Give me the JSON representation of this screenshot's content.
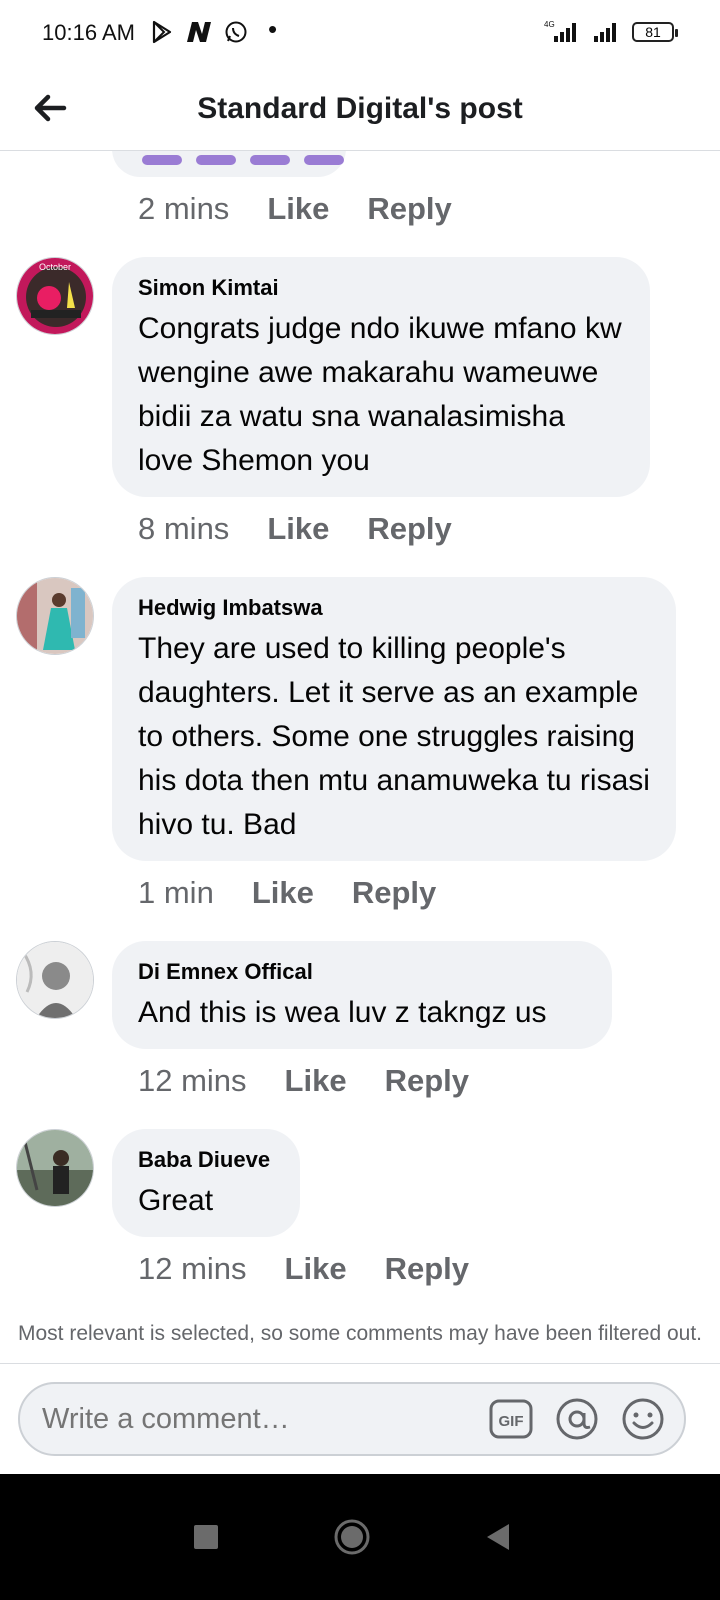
{
  "status_bar": {
    "time": "10:16 AM",
    "battery": "81",
    "network": "4G"
  },
  "header": {
    "title": "Standard Digital's post"
  },
  "comments": [
    {
      "name": "",
      "text": "",
      "time": "2 mins",
      "like": "Like",
      "reply": "Reply"
    },
    {
      "name": "Simon Kimtai",
      "text": "Congrats judge ndo ikuwe mfano kw wengine awe makarahu wameuwe bidii za watu sna wanalasimisha love Shemon you",
      "time": "8 mins",
      "like": "Like",
      "reply": "Reply",
      "avatar_badge": "October"
    },
    {
      "name": "Hedwig Imbatswa",
      "text": "They are used to killing people's daughters.  Let it serve  as an example to others. Some one struggles raising his dota then mtu anamuweka tu risasi hivo tu. Bad",
      "time": "1 min",
      "like": "Like",
      "reply": "Reply"
    },
    {
      "name": "Di Emnex Offical",
      "text": "And this is wea luv z takngz us",
      "time": "12 mins",
      "like": "Like",
      "reply": "Reply"
    },
    {
      "name": "Baba Diueve",
      "text": "Great",
      "time": "12 mins",
      "like": "Like",
      "reply": "Reply"
    }
  ],
  "footer": {
    "notice": "Most relevant is selected, so some comments may have been filtered out.",
    "composer_placeholder": "Write a comment…",
    "gif_label": "GIF"
  },
  "colors": {
    "bubble": "#f0f2f5",
    "meta": "#65676b",
    "text": "#050505",
    "sticker": "#9a7cd4"
  },
  "icons": [
    "back-arrow-icon",
    "play-store-icon",
    "n-app-icon",
    "whatsapp-icon",
    "signal-icon",
    "battery-icon",
    "gif-icon",
    "mention-icon",
    "emoji-icon",
    "square-icon",
    "circle-home-icon",
    "triangle-back-icon"
  ]
}
